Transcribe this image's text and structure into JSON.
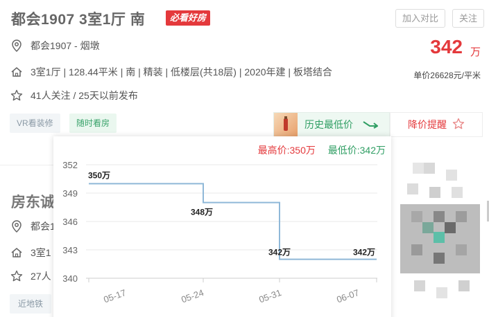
{
  "listing": {
    "title": "都会1907 3室1厅 南",
    "badge": "必看好房",
    "compare_label": "加入对比",
    "follow_label": "关注",
    "community": "都会1907 - 烟墩",
    "details": "3室1厅 | 128.44平米 | 南 | 精装 | 低楼层(共18层) | 2020年建 | 板塔结合",
    "followers": "41人关注 / 25天以前发布",
    "price": "342",
    "price_unit": "万",
    "unit_price": "单价26628元/平米",
    "tags": [
      "VR看装修",
      "随时看房"
    ],
    "history_label": "历史最低价",
    "alert_label": "降价提醒"
  },
  "listing2": {
    "title": "房东诚",
    "community": "都会1",
    "details": "3室1",
    "followers": "27人",
    "tag": "近地铁"
  },
  "chart_popup": {
    "max_label": "最高价:350万",
    "min_label": "最低价:342万"
  },
  "colors": {
    "accent_red": "#e4393c",
    "accent_green": "#2f9e63",
    "line": "#8fb8d8"
  },
  "chart_data": {
    "type": "line",
    "step": true,
    "x": [
      "05-17",
      "05-24",
      "05-31",
      "06-07"
    ],
    "y_ticks": [
      352,
      349,
      346,
      343,
      340
    ],
    "ylim": [
      340,
      352
    ],
    "points": [
      {
        "x": "05-17",
        "y": 350,
        "label": "350万"
      },
      {
        "x": "05-24",
        "y": 348,
        "label": "348万"
      },
      {
        "x": "05-31",
        "y": 342,
        "label": "342万"
      },
      {
        "x": "06-07",
        "y": 342,
        "label": "342万"
      }
    ],
    "grid": true
  }
}
